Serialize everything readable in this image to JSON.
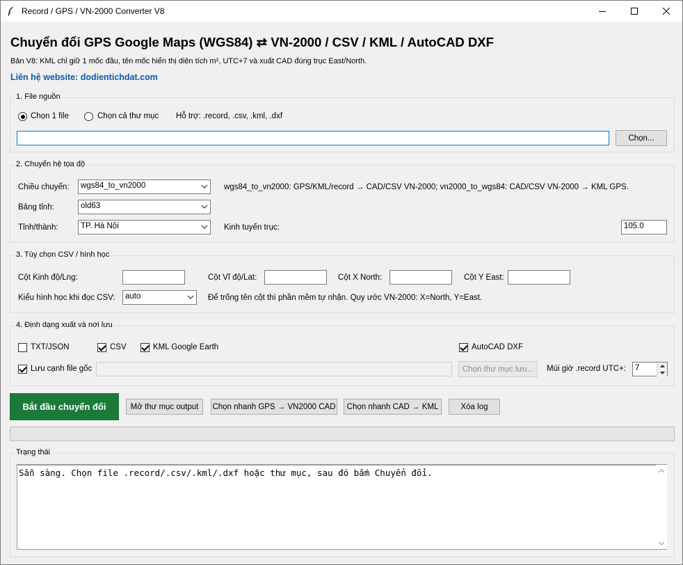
{
  "window": {
    "title": "Record / GPS / VN-2000 Converter V8"
  },
  "header": {
    "title": "Chuyển đổi GPS Google Maps (WGS84) ⇄ VN-2000 / CSV / KML / AutoCAD DXF",
    "subtitle": "Bản V8: KML chỉ giữ 1 mốc đầu, tên mốc hiển thị diện tích m², UTC+7 và xuất CAD đúng trục East/North.",
    "link": "Liên hệ website: dodientichdat.com"
  },
  "source": {
    "legend": "1. File nguồn",
    "radio_file": "Chọn 1 file",
    "radio_folder": "Chọn cả thư mục",
    "support": "Hỗ trợ: .record, .csv, .kml, .dxf",
    "path_value": "",
    "choose_button": "Chọn..."
  },
  "coords": {
    "legend": "2. Chuyển hệ tọa độ",
    "direction_label": "Chiều chuyển:",
    "direction_value": "wgs84_to_vn2000",
    "direction_help": "wgs84_to_vn2000: GPS/KML/record → CAD/CSV VN-2000; vn2000_to_wgs84: CAD/CSV VN-2000 → KML GPS.",
    "table_label": "Bảng tỉnh:",
    "table_value": "old63",
    "province_label": "Tỉnh/thành:",
    "province_value": "TP. Hà Nội",
    "meridian_label": "Kinh tuyến trục:",
    "meridian_value": "105.0"
  },
  "csv": {
    "legend": "3. Tùy chọn CSV / hình học",
    "lng_label": "Cột Kinh độ/Lng:",
    "lat_label": "Cột Vĩ độ/Lat:",
    "x_label": "Cột X North:",
    "y_label": "Cột Y East:",
    "lng_value": "",
    "lat_value": "",
    "x_value": "",
    "y_value": "",
    "geom_label": "Kiểu hình học khi đọc CSV:",
    "geom_value": "auto",
    "geom_help": "Để trống tên cột thì phần mềm tự nhận. Quy ước VN-2000: X=North, Y=East."
  },
  "output": {
    "legend": "4. Định dạng xuất và nơi lưu",
    "txt_json": "TXT/JSON",
    "csv": "CSV",
    "kml": "KML Google Earth",
    "dxf": "AutoCAD DXF",
    "save_beside": "Lưu cạnh file gốc",
    "folder_value": "",
    "choose_folder_button": "Chọn thư mục lưu...",
    "tz_label": "Múi giờ .record UTC+:",
    "tz_value": "7"
  },
  "actions": {
    "start": "Bắt đầu chuyển đổi",
    "open_output": "Mở thư mục output",
    "quick_gps": "Chọn nhanh GPS → VN2000 CAD",
    "quick_cad": "Chọn nhanh CAD → KML",
    "clear_log": "Xóa log"
  },
  "progress": {
    "value": 0
  },
  "status": {
    "legend": "Trạng thái",
    "log_text": "Sẵn sàng. Chọn file .record/.csv/.kml/.dxf hoặc thư mục, sau đó bấm Chuyển đổi."
  },
  "state": {
    "radio_file_selected": true,
    "radio_folder_selected": false,
    "txt_json_checked": false,
    "csv_checked": true,
    "kml_checked": true,
    "dxf_checked": true,
    "save_beside_checked": true
  },
  "colors": {
    "start_button": "#1b7a3a",
    "link": "#0b5cad"
  },
  "icons": [
    "feather-icon",
    "minimize-icon",
    "maximize-icon",
    "close-icon",
    "chevron-down-icon",
    "spin-up-icon",
    "spin-down-icon",
    "scroll-up-icon",
    "scroll-down-icon"
  ]
}
